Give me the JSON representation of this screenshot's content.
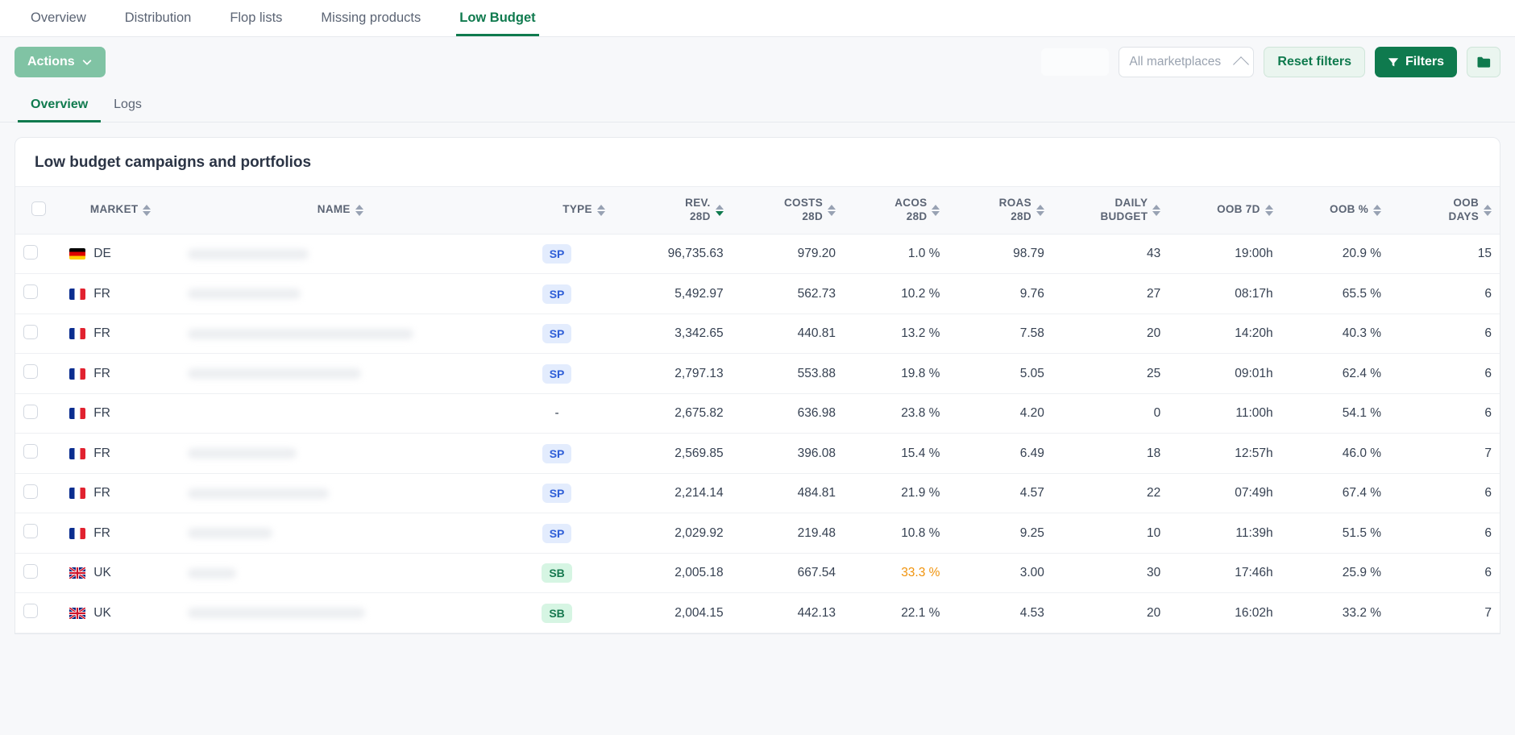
{
  "topnav": {
    "items": [
      {
        "label": "Overview",
        "active": false
      },
      {
        "label": "Distribution",
        "active": false
      },
      {
        "label": "Flop lists",
        "active": false
      },
      {
        "label": "Missing products",
        "active": false
      },
      {
        "label": "Low Budget",
        "active": true
      }
    ]
  },
  "toolbar": {
    "actions_label": "Actions",
    "marketplace_value": "All marketplaces",
    "reset_label": "Reset filters",
    "filters_label": "Filters",
    "folder_icon": "folder-icon",
    "chevron_icon": "chevron-up-icon",
    "filter_icon": "filter-icon"
  },
  "subtabs": {
    "items": [
      {
        "label": "Overview",
        "active": true
      },
      {
        "label": "Logs",
        "active": false
      }
    ]
  },
  "card": {
    "title": "Low budget campaigns and portfolios",
    "columns": [
      {
        "key": "market",
        "label": "MARKET",
        "align": "left",
        "sort": "none"
      },
      {
        "key": "name",
        "label": "NAME",
        "align": "left",
        "sort": "none"
      },
      {
        "key": "type",
        "label": "TYPE",
        "align": "right",
        "sort": "none"
      },
      {
        "key": "rev",
        "label": "REV. 28D",
        "align": "right",
        "sort": "desc"
      },
      {
        "key": "costs",
        "label": "COSTS 28D",
        "align": "right",
        "sort": "none"
      },
      {
        "key": "acos",
        "label": "ACOS 28D",
        "align": "right",
        "sort": "none"
      },
      {
        "key": "roas",
        "label": "ROAS 28D",
        "align": "right",
        "sort": "none"
      },
      {
        "key": "budget",
        "label": "DAILY BUDGET",
        "align": "right",
        "sort": "none"
      },
      {
        "key": "oob7d",
        "label": "OOB 7D",
        "align": "right",
        "sort": "none"
      },
      {
        "key": "oobpct",
        "label": "OOB %",
        "align": "right",
        "sort": "none"
      },
      {
        "key": "oobdays",
        "label": "OOB DAYS",
        "align": "right",
        "sort": "none"
      }
    ],
    "rows": [
      {
        "market": "DE",
        "flag": "de",
        "name": "",
        "type": "SP",
        "rev": "96,735.63",
        "costs": "979.20",
        "acos": "1.0 %",
        "acos_warn": false,
        "roas": "98.79",
        "budget": "43",
        "oob7d": "19:00h",
        "oobpct": "20.9 %",
        "oobdays": "15"
      },
      {
        "market": "FR",
        "flag": "fr",
        "name": "",
        "type": "SP",
        "rev": "5,492.97",
        "costs": "562.73",
        "acos": "10.2 %",
        "acos_warn": false,
        "roas": "9.76",
        "budget": "27",
        "oob7d": "08:17h",
        "oobpct": "65.5 %",
        "oobdays": "6"
      },
      {
        "market": "FR",
        "flag": "fr",
        "name": "",
        "type": "SP",
        "rev": "3,342.65",
        "costs": "440.81",
        "acos": "13.2 %",
        "acos_warn": false,
        "roas": "7.58",
        "budget": "20",
        "oob7d": "14:20h",
        "oobpct": "40.3 %",
        "oobdays": "6"
      },
      {
        "market": "FR",
        "flag": "fr",
        "name": "",
        "type": "SP",
        "rev": "2,797.13",
        "costs": "553.88",
        "acos": "19.8 %",
        "acos_warn": false,
        "roas": "5.05",
        "budget": "25",
        "oob7d": "09:01h",
        "oobpct": "62.4 %",
        "oobdays": "6"
      },
      {
        "market": "FR",
        "flag": "fr",
        "name": "",
        "type": "-",
        "rev": "2,675.82",
        "costs": "636.98",
        "acos": "23.8 %",
        "acos_warn": false,
        "roas": "4.20",
        "budget": "0",
        "oob7d": "11:00h",
        "oobpct": "54.1 %",
        "oobdays": "6"
      },
      {
        "market": "FR",
        "flag": "fr",
        "name": "",
        "type": "SP",
        "rev": "2,569.85",
        "costs": "396.08",
        "acos": "15.4 %",
        "acos_warn": false,
        "roas": "6.49",
        "budget": "18",
        "oob7d": "12:57h",
        "oobpct": "46.0 %",
        "oobdays": "7"
      },
      {
        "market": "FR",
        "flag": "fr",
        "name": "",
        "type": "SP",
        "rev": "2,214.14",
        "costs": "484.81",
        "acos": "21.9 %",
        "acos_warn": false,
        "roas": "4.57",
        "budget": "22",
        "oob7d": "07:49h",
        "oobpct": "67.4 %",
        "oobdays": "6"
      },
      {
        "market": "FR",
        "flag": "fr",
        "name": "",
        "type": "SP",
        "rev": "2,029.92",
        "costs": "219.48",
        "acos": "10.8 %",
        "acos_warn": false,
        "roas": "9.25",
        "budget": "10",
        "oob7d": "11:39h",
        "oobpct": "51.5 %",
        "oobdays": "6"
      },
      {
        "market": "UK",
        "flag": "uk",
        "name": "",
        "type": "SB",
        "rev": "2,005.18",
        "costs": "667.54",
        "acos": "33.3 %",
        "acos_warn": true,
        "roas": "3.00",
        "budget": "30",
        "oob7d": "17:46h",
        "oobpct": "25.9 %",
        "oobdays": "6"
      },
      {
        "market": "UK",
        "flag": "uk",
        "name": "",
        "type": "SB",
        "rev": "2,004.15",
        "costs": "442.13",
        "acos": "22.1 %",
        "acos_warn": false,
        "roas": "4.53",
        "budget": "20",
        "oob7d": "16:02h",
        "oobpct": "33.2 %",
        "oobdays": "7"
      }
    ]
  },
  "colors": {
    "brand_green": "#0f7a4e",
    "warn_orange": "#f0930c",
    "badge_sp_bg": "#e3ecfd",
    "badge_sp_fg": "#2f5fd8",
    "badge_sb_bg": "#d6f5e3",
    "badge_sb_fg": "#16794f"
  }
}
